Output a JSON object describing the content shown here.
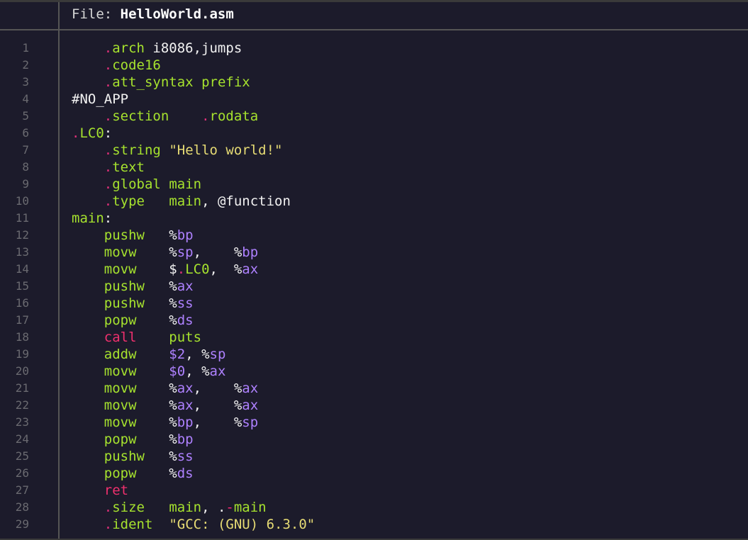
{
  "header": {
    "prefix": "File: ",
    "filename": "HelloWorld.asm"
  },
  "colors": {
    "background": "#1c1b2b",
    "line_number": "#6a6a70",
    "directive_dot": "#e0307a",
    "identifier": "#a6e22e",
    "keyword": "#f0306e",
    "register": "#ae81ff",
    "string": "#e6db74",
    "plain": "#f2f2f2"
  },
  "lines": [
    {
      "n": "1",
      "tokens": [
        [
          "pl",
          "    "
        ],
        [
          "dot",
          "."
        ],
        [
          "dir",
          "arch"
        ],
        [
          "pl",
          " i8086,jumps"
        ]
      ]
    },
    {
      "n": "2",
      "tokens": [
        [
          "pl",
          "    "
        ],
        [
          "dot",
          "."
        ],
        [
          "dir",
          "code16"
        ]
      ]
    },
    {
      "n": "3",
      "tokens": [
        [
          "pl",
          "    "
        ],
        [
          "dot",
          "."
        ],
        [
          "dir",
          "att_syntax"
        ],
        [
          "pl",
          " "
        ],
        [
          "id",
          "prefix"
        ]
      ]
    },
    {
      "n": "4",
      "tokens": [
        [
          "pl",
          "#NO_APP"
        ]
      ]
    },
    {
      "n": "5",
      "tokens": [
        [
          "pl",
          "    "
        ],
        [
          "dot",
          "."
        ],
        [
          "dir",
          "section"
        ],
        [
          "pl",
          "    "
        ],
        [
          "dot",
          "."
        ],
        [
          "id",
          "rodata"
        ]
      ]
    },
    {
      "n": "6",
      "tokens": [
        [
          "dot",
          "."
        ],
        [
          "lbl",
          "LC0"
        ],
        [
          "pl",
          ":"
        ]
      ]
    },
    {
      "n": "7",
      "tokens": [
        [
          "pl",
          "    "
        ],
        [
          "dot",
          "."
        ],
        [
          "dir",
          "string"
        ],
        [
          "pl",
          " "
        ],
        [
          "str",
          "\"Hello world!\""
        ]
      ]
    },
    {
      "n": "8",
      "tokens": [
        [
          "pl",
          "    "
        ],
        [
          "dot",
          "."
        ],
        [
          "dir",
          "text"
        ]
      ]
    },
    {
      "n": "9",
      "tokens": [
        [
          "pl",
          "    "
        ],
        [
          "dot",
          "."
        ],
        [
          "dir",
          "global"
        ],
        [
          "pl",
          " "
        ],
        [
          "id",
          "main"
        ]
      ]
    },
    {
      "n": "10",
      "tokens": [
        [
          "pl",
          "    "
        ],
        [
          "dot",
          "."
        ],
        [
          "dir",
          "type"
        ],
        [
          "pl",
          "   "
        ],
        [
          "id",
          "main"
        ],
        [
          "pl",
          ", @function"
        ]
      ]
    },
    {
      "n": "11",
      "tokens": [
        [
          "lbl",
          "main"
        ],
        [
          "pl",
          ":"
        ]
      ]
    },
    {
      "n": "12",
      "tokens": [
        [
          "pl",
          "    "
        ],
        [
          "ins",
          "pushw"
        ],
        [
          "pl",
          "   %"
        ],
        [
          "reg",
          "bp"
        ]
      ]
    },
    {
      "n": "13",
      "tokens": [
        [
          "pl",
          "    "
        ],
        [
          "ins",
          "movw"
        ],
        [
          "pl",
          "    %"
        ],
        [
          "reg",
          "sp"
        ],
        [
          "pl",
          ",    %"
        ],
        [
          "reg",
          "bp"
        ]
      ]
    },
    {
      "n": "14",
      "tokens": [
        [
          "pl",
          "    "
        ],
        [
          "ins",
          "movw"
        ],
        [
          "pl",
          "    $"
        ],
        [
          "dot",
          "."
        ],
        [
          "lbl",
          "LC0"
        ],
        [
          "pl",
          ",  %"
        ],
        [
          "reg",
          "ax"
        ]
      ]
    },
    {
      "n": "15",
      "tokens": [
        [
          "pl",
          "    "
        ],
        [
          "ins",
          "pushw"
        ],
        [
          "pl",
          "   %"
        ],
        [
          "reg",
          "ax"
        ]
      ]
    },
    {
      "n": "16",
      "tokens": [
        [
          "pl",
          "    "
        ],
        [
          "ins",
          "pushw"
        ],
        [
          "pl",
          "   %"
        ],
        [
          "reg",
          "ss"
        ]
      ]
    },
    {
      "n": "17",
      "tokens": [
        [
          "pl",
          "    "
        ],
        [
          "ins",
          "popw"
        ],
        [
          "pl",
          "    %"
        ],
        [
          "reg",
          "ds"
        ]
      ]
    },
    {
      "n": "18",
      "tokens": [
        [
          "pl",
          "    "
        ],
        [
          "kw",
          "call"
        ],
        [
          "pl",
          "    "
        ],
        [
          "id",
          "puts"
        ]
      ]
    },
    {
      "n": "19",
      "tokens": [
        [
          "pl",
          "    "
        ],
        [
          "ins",
          "addw"
        ],
        [
          "pl",
          "    "
        ],
        [
          "num",
          "$2"
        ],
        [
          "pl",
          ", %"
        ],
        [
          "reg",
          "sp"
        ]
      ]
    },
    {
      "n": "20",
      "tokens": [
        [
          "pl",
          "    "
        ],
        [
          "ins",
          "movw"
        ],
        [
          "pl",
          "    "
        ],
        [
          "num",
          "$0"
        ],
        [
          "pl",
          ", %"
        ],
        [
          "reg",
          "ax"
        ]
      ]
    },
    {
      "n": "21",
      "tokens": [
        [
          "pl",
          "    "
        ],
        [
          "ins",
          "movw"
        ],
        [
          "pl",
          "    %"
        ],
        [
          "reg",
          "ax"
        ],
        [
          "pl",
          ",    %"
        ],
        [
          "reg",
          "ax"
        ]
      ]
    },
    {
      "n": "22",
      "tokens": [
        [
          "pl",
          "    "
        ],
        [
          "ins",
          "movw"
        ],
        [
          "pl",
          "    %"
        ],
        [
          "reg",
          "ax"
        ],
        [
          "pl",
          ",    %"
        ],
        [
          "reg",
          "ax"
        ]
      ]
    },
    {
      "n": "23",
      "tokens": [
        [
          "pl",
          "    "
        ],
        [
          "ins",
          "movw"
        ],
        [
          "pl",
          "    %"
        ],
        [
          "reg",
          "bp"
        ],
        [
          "pl",
          ",    %"
        ],
        [
          "reg",
          "sp"
        ]
      ]
    },
    {
      "n": "24",
      "tokens": [
        [
          "pl",
          "    "
        ],
        [
          "ins",
          "popw"
        ],
        [
          "pl",
          "    %"
        ],
        [
          "reg",
          "bp"
        ]
      ]
    },
    {
      "n": "25",
      "tokens": [
        [
          "pl",
          "    "
        ],
        [
          "ins",
          "pushw"
        ],
        [
          "pl",
          "   %"
        ],
        [
          "reg",
          "ss"
        ]
      ]
    },
    {
      "n": "26",
      "tokens": [
        [
          "pl",
          "    "
        ],
        [
          "ins",
          "popw"
        ],
        [
          "pl",
          "    %"
        ],
        [
          "reg",
          "ds"
        ]
      ]
    },
    {
      "n": "27",
      "tokens": [
        [
          "pl",
          "    "
        ],
        [
          "kw",
          "ret"
        ]
      ]
    },
    {
      "n": "28",
      "tokens": [
        [
          "pl",
          "    "
        ],
        [
          "dot",
          "."
        ],
        [
          "dir",
          "size"
        ],
        [
          "pl",
          "   "
        ],
        [
          "id",
          "main"
        ],
        [
          "pl",
          ", ."
        ],
        [
          "op",
          "-"
        ],
        [
          "id",
          "main"
        ]
      ]
    },
    {
      "n": "29",
      "tokens": [
        [
          "pl",
          "    "
        ],
        [
          "dot",
          "."
        ],
        [
          "dir",
          "ident"
        ],
        [
          "pl",
          "  "
        ],
        [
          "str",
          "\"GCC: (GNU) 6.3.0\""
        ]
      ]
    }
  ]
}
